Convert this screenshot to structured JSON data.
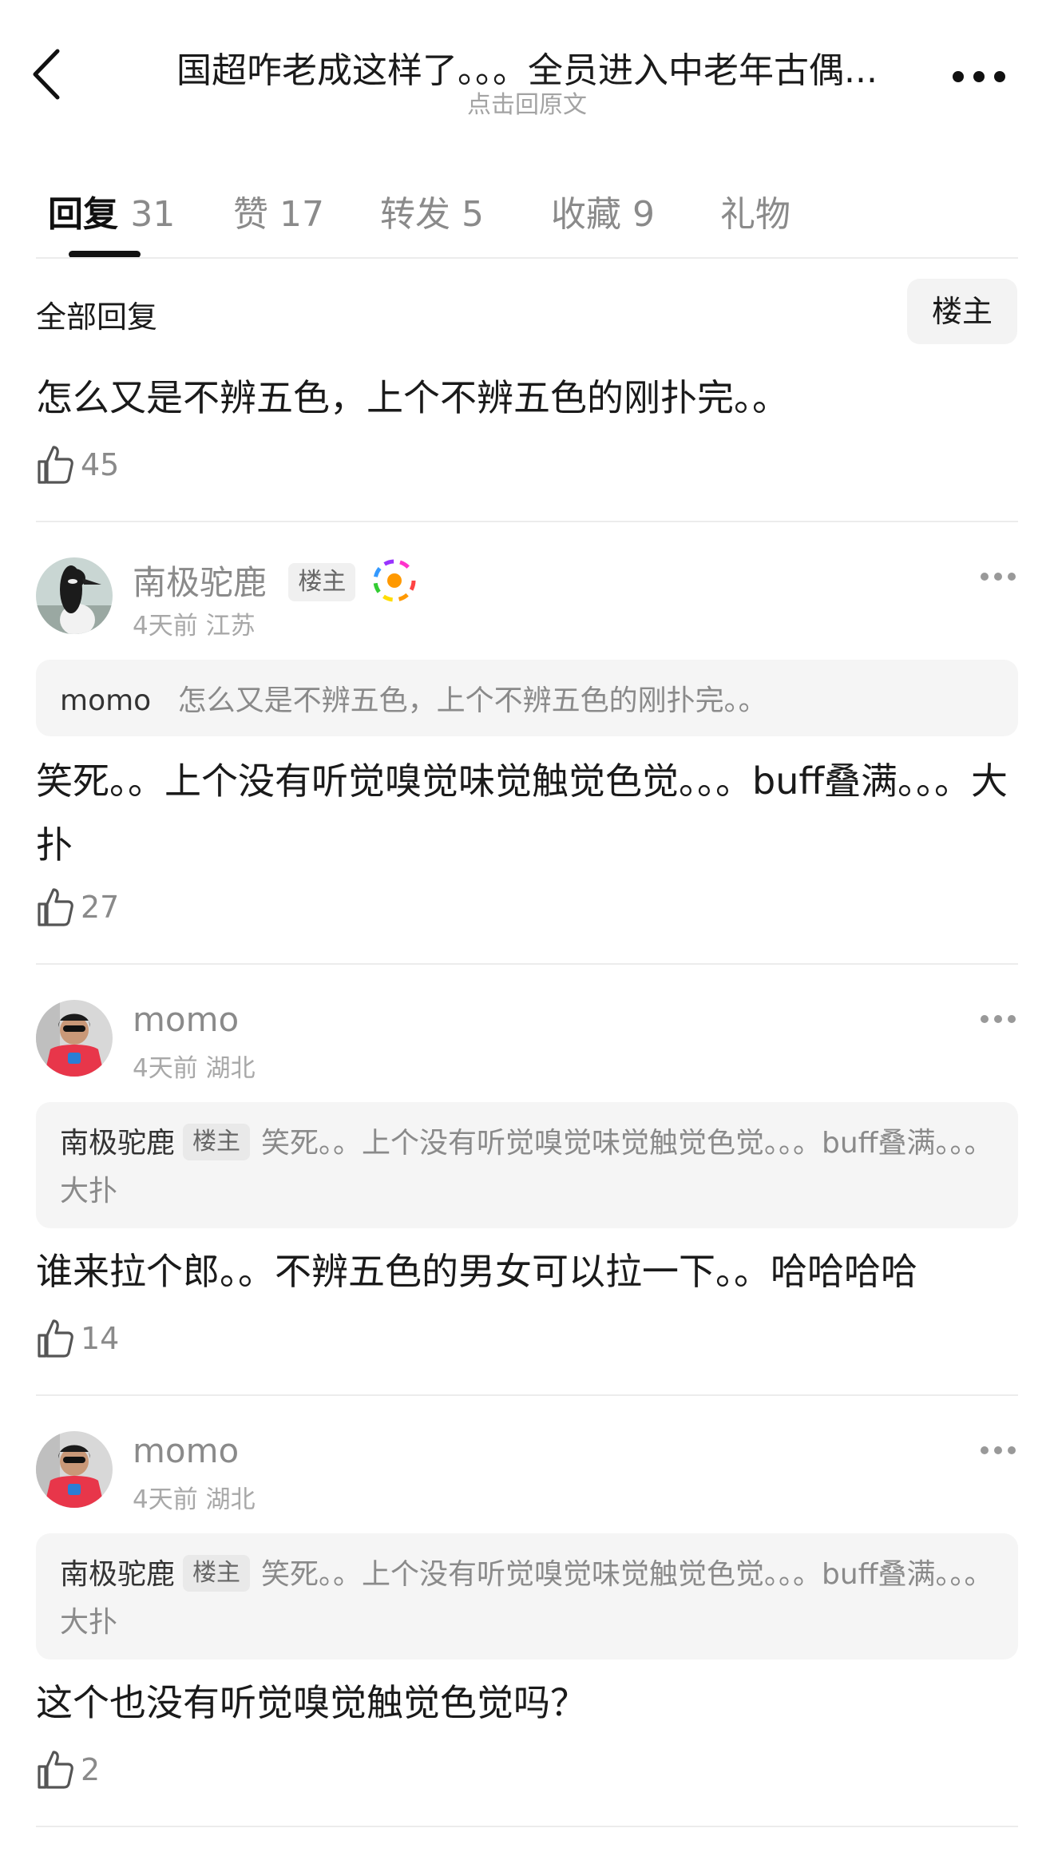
{
  "header": {
    "title": "国超咋老成这样了。。。全员进入中老年古偶...",
    "subtitle": "点击回原文"
  },
  "tabs": [
    {
      "label": "回复",
      "count": "31"
    },
    {
      "label": "赞",
      "count": "17"
    },
    {
      "label": "转发",
      "count": "5"
    },
    {
      "label": "收藏",
      "count": "9"
    },
    {
      "label": "礼物",
      "count": ""
    }
  ],
  "section": {
    "title": "全部回复",
    "filter_label": "楼主"
  },
  "root_comment": {
    "text": "怎么又是不辨五色，上个不辨五色的刚扑完。。",
    "likes": "45"
  },
  "replies": [
    {
      "user": "南极驼鹿",
      "owner_badge": "楼主",
      "meta": "4天前 江苏",
      "quote_user": "momo",
      "quote_badge": "",
      "quote_text": "怎么又是不辨五色，上个不辨五色的刚扑完。。",
      "text": "笑死。。上个没有听觉嗅觉味觉触觉色觉。。。buff叠满。。。大扑",
      "likes": "27"
    },
    {
      "user": "momo",
      "owner_badge": "",
      "meta": "4天前 湖北",
      "quote_user": "南极驼鹿",
      "quote_badge": "楼主",
      "quote_text": "笑死。。上个没有听觉嗅觉味觉触觉色觉。。。buff叠满。。。大扑",
      "text": "谁来拉个郎。。不辨五色的男女可以拉一下。。哈哈哈哈",
      "likes": "14"
    },
    {
      "user": "momo",
      "owner_badge": "",
      "meta": "4天前 湖北",
      "quote_user": "南极驼鹿",
      "quote_badge": "楼主",
      "quote_text": "笑死。。上个没有听觉嗅觉味觉触觉色觉。。。buff叠满。。。大扑",
      "text": "这个也没有听觉嗅觉触觉色觉吗？",
      "likes": "2"
    }
  ],
  "icons": {
    "back": "chevron-left-icon",
    "more": "more-horizontal-icon",
    "like": "thumbs-up-icon",
    "avatar_deco": "rainbow-ring-badge-icon"
  }
}
